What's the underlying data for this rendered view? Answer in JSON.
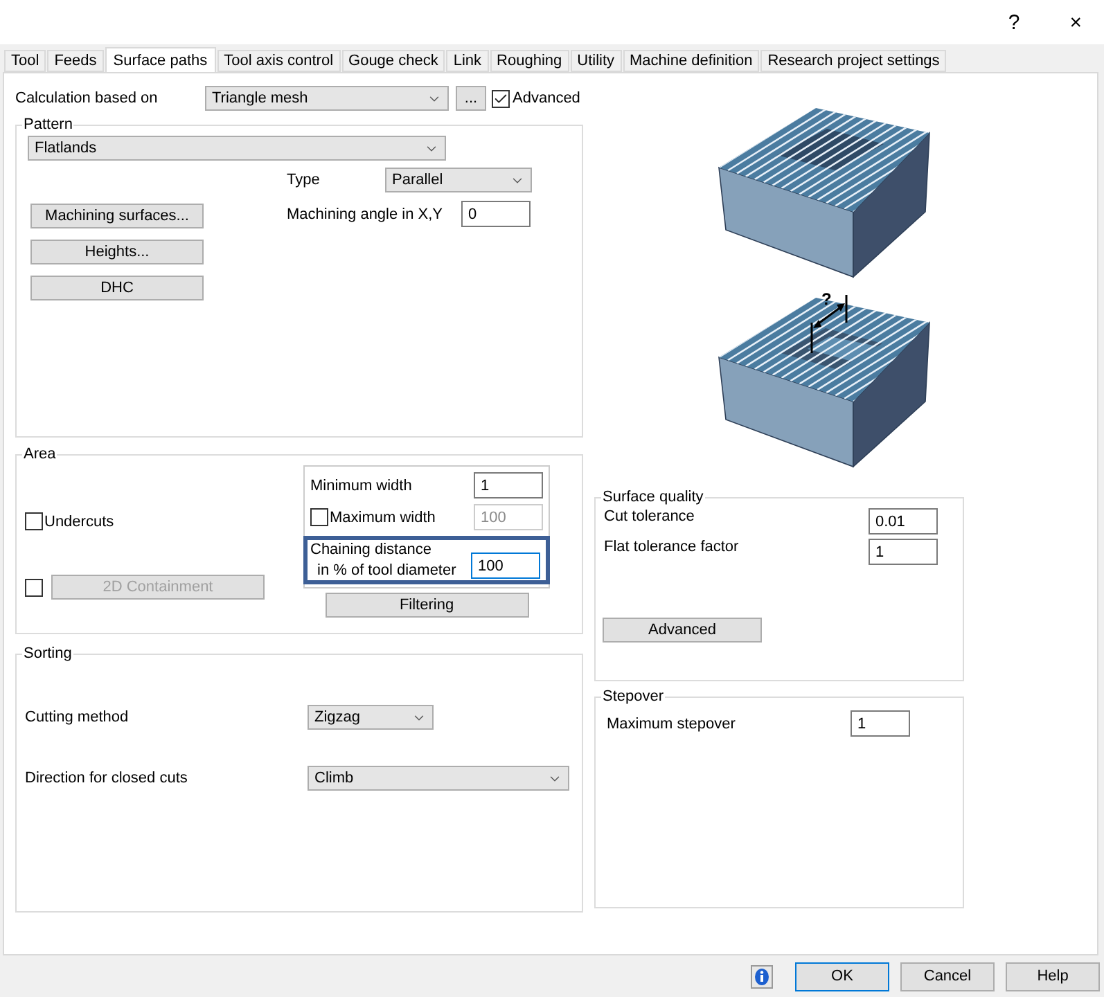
{
  "window": {
    "help_button": "?",
    "close_button": "×"
  },
  "tabs": [
    {
      "label": "Tool",
      "selected": false
    },
    {
      "label": "Feeds",
      "selected": false
    },
    {
      "label": "Surface paths",
      "selected": true
    },
    {
      "label": "Tool axis control",
      "selected": false
    },
    {
      "label": "Gouge check",
      "selected": false
    },
    {
      "label": "Link",
      "selected": false
    },
    {
      "label": "Roughing",
      "selected": false
    },
    {
      "label": "Utility",
      "selected": false
    },
    {
      "label": "Machine definition",
      "selected": false
    },
    {
      "label": "Research project settings",
      "selected": false
    }
  ],
  "calculation": {
    "label": "Calculation based on",
    "value": "Triangle mesh",
    "more_button": "...",
    "advanced": {
      "label": "Advanced",
      "checked": true
    }
  },
  "pattern": {
    "title": "Pattern",
    "value": "Flatlands",
    "buttons": [
      "Machining surfaces...",
      "Heights...",
      "DHC"
    ],
    "type": {
      "label": "Type",
      "value": "Parallel"
    },
    "angle": {
      "label": "Machining angle in X,Y",
      "value": "0"
    }
  },
  "illustration": {
    "label": "?"
  },
  "area": {
    "title": "Area",
    "undercuts": {
      "label": "Undercuts",
      "checked": false
    },
    "containment": {
      "checked": false,
      "button": "2D Containment",
      "disabled": true
    },
    "min_width": {
      "label": "Minimum width",
      "value": "1"
    },
    "max_width": {
      "label": "Maximum width",
      "checked": false,
      "value": "100",
      "disabled": true
    },
    "chaining": {
      "label": "Chaining distance",
      "sublabel": "in % of tool diameter",
      "value": "100",
      "focused": true,
      "highlighted": true
    },
    "filter_button": "Filtering"
  },
  "surface_quality": {
    "title": "Surface quality",
    "fields": [
      {
        "label": "Cut tolerance",
        "value": "0.01"
      },
      {
        "label": "Flat tolerance factor",
        "value": "1"
      }
    ],
    "button": "Advanced"
  },
  "sorting": {
    "title": "Sorting",
    "fields": [
      {
        "label": "Cutting method",
        "value": "Zigzag",
        "wide": false
      },
      {
        "label": "Direction for closed cuts",
        "value": "Climb",
        "wide": true
      }
    ]
  },
  "stepover": {
    "title": "Stepover",
    "label": "Maximum stepover",
    "value": "1"
  },
  "footer": {
    "buttons": [
      {
        "label": "OK",
        "default": true
      },
      {
        "label": "Cancel",
        "default": false
      },
      {
        "label": "Help",
        "default": false
      }
    ]
  }
}
